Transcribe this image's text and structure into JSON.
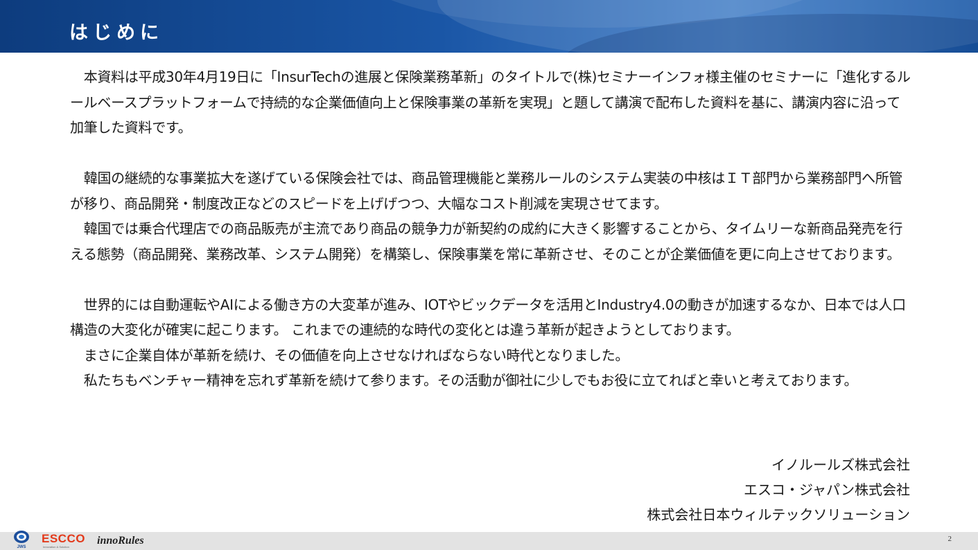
{
  "header": {
    "title": "はじめに"
  },
  "body": {
    "paragraphs": [
      "　本資料は平成30年4月19日に「InsurTechの進展と保険業務革新」のタイトルで(株)セミナーインフォ様主催のセミナーに「進化するルールベースプラットフォームで持続的な企業価値向上と保険事業の革新を実現」と題して講演で配布した資料を基に、講演内容に沿って加筆した資料です。",
      "",
      "　韓国の継続的な事業拡大を遂げている保険会社では、商品管理機能と業務ルールのシステム実装の中核はＩＴ部門から業務部門へ所管が移り、商品開発・制度改正などのスピードを上げげつつ、大幅なコスト削減を実現させてます。",
      "　韓国では乗合代理店での商品販売が主流であり商品の競争力が新契約の成約に大きく影響することから、タイムリーな新商品発売を行える態勢（商品開発、業務改革、システム開発）を構築し、保険事業を常に革新させ、そのことが企業価値を更に向上させております。",
      "",
      "　世界的には自動運転やAIによる働き方の大変革が進み、IOTやビックデータを活用とIndustry4.0の動きが加速するなか、日本では人口構造の大変化が確実に起こります。 これまでの連続的な時代の変化とは違う革新が起きようとしております。",
      "　まさに企業自体が革新を続け、その価値を向上させなければならない時代となりました。",
      "　私たちもベンチャー精神を忘れず革新を続けて参ります。その活動が御社に少しでもお役に立てればと幸いと考えております。"
    ]
  },
  "signature": {
    "lines": [
      "イノルールズ株式会社",
      "エスコ・ジャパン株式会社",
      "株式会社日本ウィルテックソリューション"
    ]
  },
  "footer": {
    "logos": {
      "jws": "JWS",
      "escco": "ESCCO",
      "escco_sub": "Innovation & Solution",
      "innorules": "innoRules"
    },
    "page_number": "2"
  },
  "colors": {
    "header_dark": "#0d3c7e",
    "header_light": "#3f7cc6",
    "escco_red": "#e33a1b",
    "footer_bg": "#e3e3e3"
  }
}
